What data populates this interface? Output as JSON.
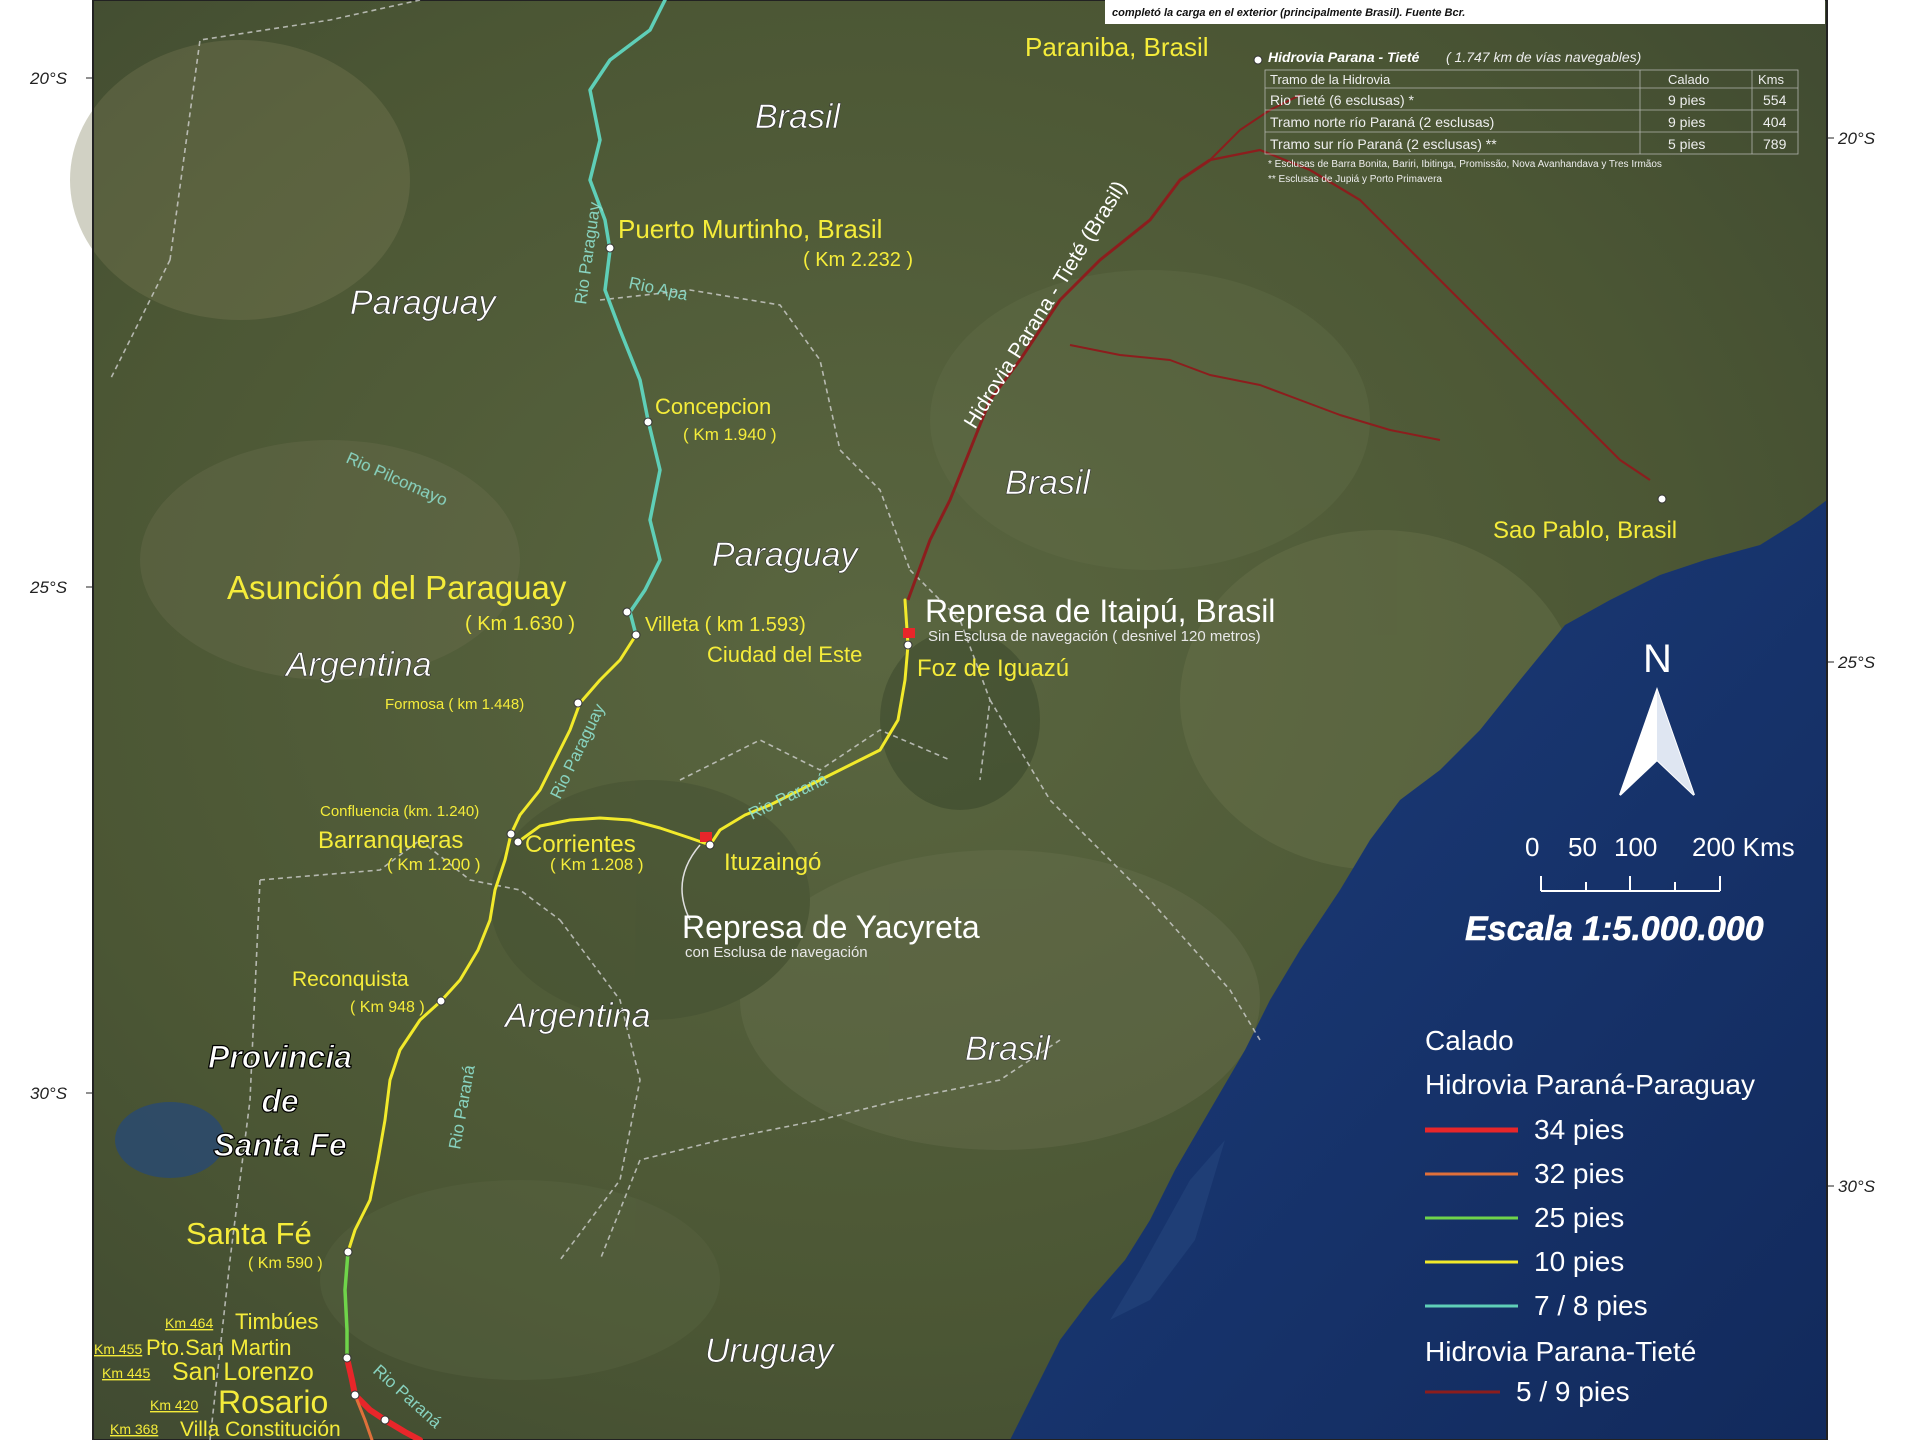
{
  "colors": {
    "d34": "#e8262a",
    "d32": "#e0703a",
    "d25": "#6fd44a",
    "d10": "#f2ea2b",
    "d78": "#5fcfb8",
    "tiete": "#8c1d1d",
    "label": "#f5ec3a",
    "sea": "#1a3a78",
    "land": "#4e5a36"
  },
  "lat_ticks_left": [
    "20°S",
    "25°S",
    "30°S"
  ],
  "lat_ticks_right": [
    "20°S",
    "25°S",
    "30°S"
  ],
  "countries": {
    "brasil_n": "Brasil",
    "brasil_c": "Brasil",
    "brasil_s": "Brasil",
    "paraguay_n": "Paraguay",
    "paraguay_s": "Paraguay",
    "argentina_n": "Argentina",
    "argentina_s": "Argentina",
    "uruguay": "Uruguay"
  },
  "province": [
    "Provincia",
    "de",
    "Santa Fe"
  ],
  "rivers": {
    "paraguay": "Rio Paraguay",
    "paraguay2": "Rio Paraguay",
    "pilcomayo": "Rio Pilcomayo",
    "parana1": "Rio Paraná",
    "parana2": "Rio Paraná",
    "parana3": "Rio Paraná",
    "tiete": "Hidrovia Parana - Tieté (Brasil)",
    "apa": "Rio Apa"
  },
  "cities": {
    "paranaiba": "Paraniba, Brasil",
    "murtinho": "Puerto Murtinho, Brasil",
    "murtinho_km": "( Km 2.232 )",
    "concepcion": "Concepcion",
    "concepcion_km": "( Km 1.940 )",
    "asuncion": "Asunción del Paraguay",
    "asuncion_km": "( Km 1.630 )",
    "villeta": "Villeta ( km 1.593)",
    "formosa": "Formosa ( km 1.448)",
    "ciudad_este": "Ciudad del Este",
    "foz": "Foz de Iguazú",
    "itaipu": "Represa de Itaipú, Brasil",
    "itaipu_note": "Sin Esclusa de navegación ( desnivel 120 metros)",
    "confluencia": "Confluencia (km. 1.240)",
    "barranqueras": "Barranqueras",
    "barranqueras_km": "( Km 1.200 )",
    "corrientes": "Corrientes",
    "corrientes_km": "( Km 1.208 )",
    "ituzaingo": "Ituzaingó",
    "yacyreta": "Represa de Yacyreta",
    "yacyreta_note": "con Esclusa de navegación",
    "reconquista": "Reconquista",
    "reconquista_km": "( Km 948 )",
    "santafe": "Santa Fé",
    "santafe_km": "( Km 590 )",
    "saopablo": "Sao Pablo, Brasil",
    "timbues": "Timbúes",
    "timbues_km": "Km 464",
    "sanmartin": "Pto.San Martin",
    "sanmartin_km": "Km 455",
    "sanlorenzo": "San Lorenzo",
    "sanlorenzo_km": "Km 445",
    "rosario": "Rosario",
    "rosario_km": "Km 420",
    "villacons": "Villa Constitución",
    "villacons_km": "Km 368"
  },
  "topnote": "completó la carga en el exterior (principalmente Brasil). Fuente Bcr.",
  "tiete_table": {
    "title": "Hidrovia Parana - Tieté",
    "subtitle": "( 1.747 km de vías navegables)",
    "headers": [
      "Tramo de la Hidrovia",
      "Calado",
      "Kms"
    ],
    "rows": [
      [
        "Rio Tieté (6 esclusas) *",
        "9 pies",
        "554"
      ],
      [
        "Tramo norte río Paraná (2 esclusas)",
        "9 pies",
        "404"
      ],
      [
        "Tramo sur río Paraná (2 esclusas) **",
        "5 pies",
        "789"
      ]
    ],
    "footnote1": "* Esclusas de Barra Bonita, Bariri, Ibitinga, Promissão, Nova Avanhandava y Tres Irmãos",
    "footnote2": "** Esclusas de Jupiá y Porto Primavera"
  },
  "north": "N",
  "scale": {
    "ticks": [
      "0",
      "50",
      "100",
      "200 Kms"
    ],
    "text": "Escala 1:5.000.000"
  },
  "legend": {
    "title": "Calado",
    "group1": "Hidrovia Paraná-Paraguay",
    "items": [
      "34 pies",
      "32 pies",
      "25 pies",
      "10 pies",
      "7 / 8 pies"
    ],
    "group2": "Hidrovia Parana-Tieté",
    "item2": "5 / 9 pies"
  }
}
